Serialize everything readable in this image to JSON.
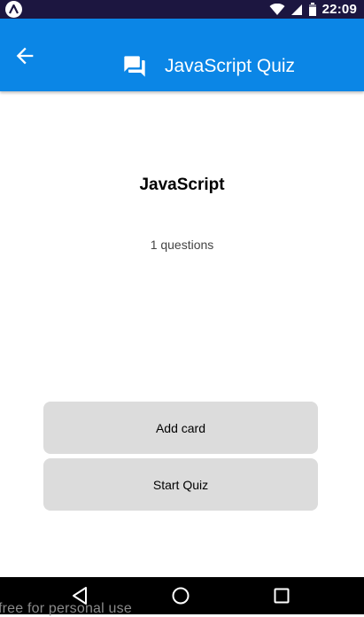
{
  "status_bar": {
    "time": "22:09",
    "icons": [
      "wifi-icon",
      "signal-icon",
      "battery-icon"
    ]
  },
  "app_bar": {
    "title": "JavaScript Quiz",
    "back_icon": "arrow-back-icon",
    "title_icon": "forum-icon",
    "color": "#0b86e6"
  },
  "deck": {
    "title": "JavaScript",
    "count_text": "1 questions"
  },
  "buttons": {
    "add_card": "Add card",
    "start_quiz": "Start Quiz"
  },
  "nav_bar": {
    "icons": [
      "nav-back-icon",
      "nav-home-icon",
      "nav-recents-icon"
    ]
  },
  "watermark": {
    "text": "free for personal use"
  }
}
